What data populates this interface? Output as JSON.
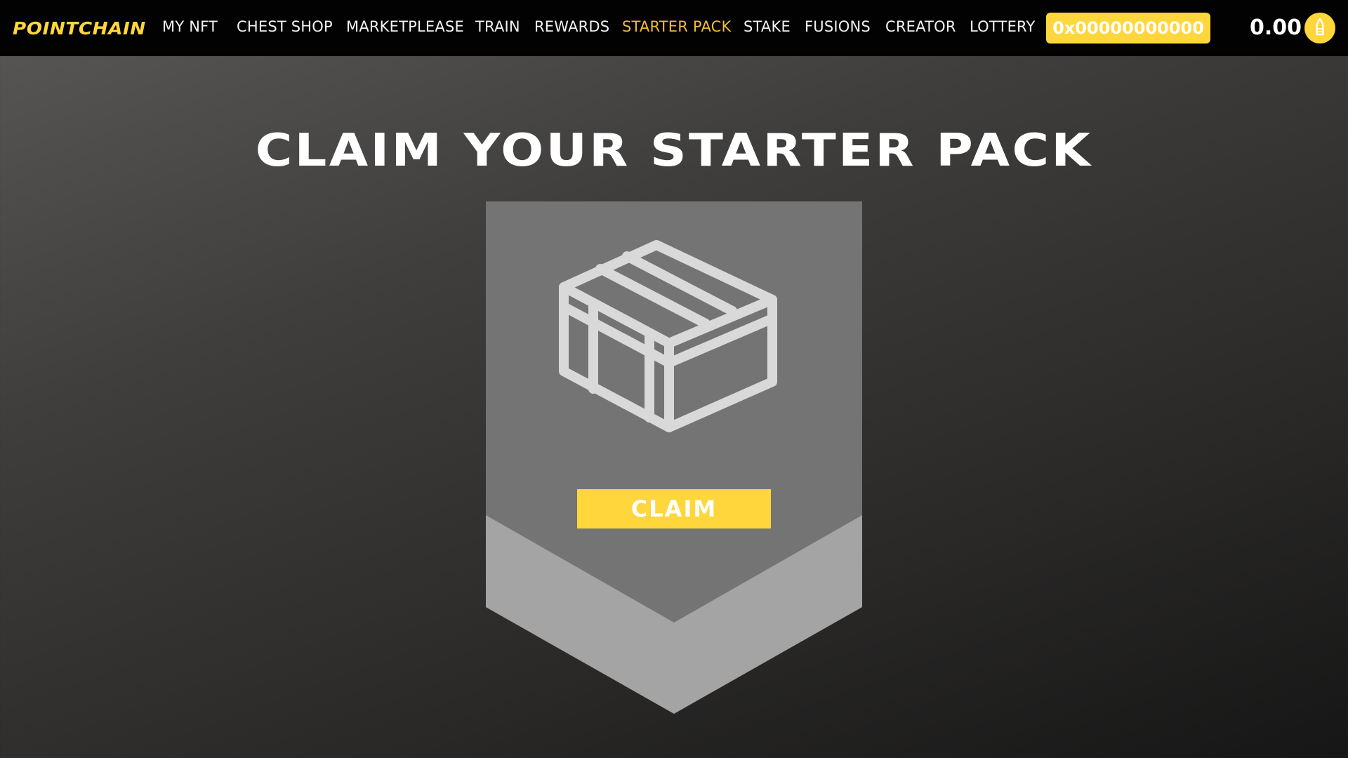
{
  "nav": {
    "logo": "POINTCHAIN",
    "items": [
      {
        "label": "MY NFT"
      },
      {
        "label": "CHEST SHOP"
      },
      {
        "label": "MARKETPLEASE"
      },
      {
        "label": "TRAIN"
      },
      {
        "label": "REWARDS"
      },
      {
        "label": "STARTER PACK",
        "active": true
      },
      {
        "label": "STAKE"
      },
      {
        "label": "FUSIONS"
      },
      {
        "label": "CREATOR"
      },
      {
        "label": "LOTTERY"
      }
    ],
    "wallet_address": "0x00000000000",
    "balance": "0.00",
    "balance_icon": "coin-icon"
  },
  "main": {
    "title": "CLAIM YOUR STARTER PACK",
    "chest_icon": "chest-icon",
    "claim_label": "CLAIM"
  },
  "colors": {
    "accent": "#ffd63b",
    "active_nav": "#f2b93e",
    "navbar_bg": "#020202",
    "card_top": "#747474",
    "card_bottom": "#a4a4a4",
    "icon": "#d9d9d9"
  }
}
